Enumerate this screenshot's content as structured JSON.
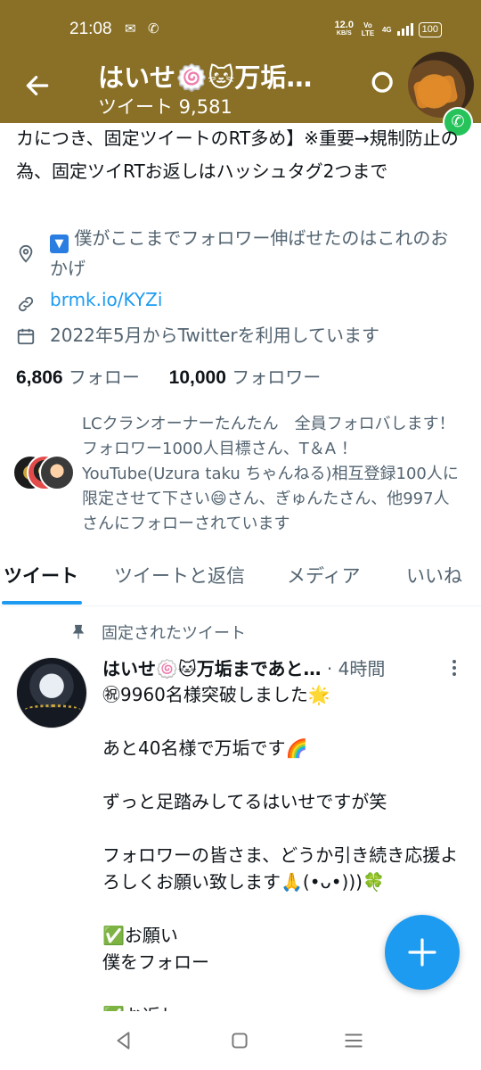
{
  "status_bar": {
    "time": "21:08",
    "speed_value": "12.0",
    "speed_unit": "KB/S",
    "volte": "Vo LTE",
    "network": "4G",
    "battery": "100"
  },
  "header": {
    "display_name": "はいせ🍥🐱万垢…",
    "tweet_count": "ツイート 9,581"
  },
  "profile": {
    "bio": "カにつき、固定ツイートのRT多め】※重要→規制防止の為、固定ツイRTお返しはハッシュタグ2つまで",
    "location_box": "▼",
    "location_text": "僕がここまでフォロワー伸ばせたのはこれのおかげ",
    "website": "brmk.io/KYZi",
    "joined": "2022年5月からTwitterを利用しています",
    "following_count": "6,806",
    "following_label": "フォロー",
    "followers_count": "10,000",
    "followers_label": "フォロワー",
    "mutual_text": "LCクランオーナーたんたん　全員フォロバします！フォロワー1000人目標さん、T＆A ！YouTube(Uzura taku ちゃんねる)相互登録100人に限定させて下さい😄さん、ぎゅんたさん、他997人さんにフォローされています"
  },
  "tabs": [
    {
      "label": "ツイート"
    },
    {
      "label": "ツイートと返信"
    },
    {
      "label": "メディア"
    },
    {
      "label": "いいね"
    }
  ],
  "pinned_tweet": {
    "pinned_label": "固定されたツイート",
    "author": "はいせ🍥🐱万垢まであと…",
    "time": "· 4時間",
    "body": "㊗9960名様突破しました🌟\n\nあと40名様で万垢です🌈\n\nずっと足踏みしてるはいせですが笑\n\nフォロワーの皆さま、どうか引き続き応援よろしくお願い致します🙏(•ᴗ•)))🍀\n\n✅お願い\n僕をフォロー\n\n✅お返し"
  },
  "colors": {
    "header_bg": "#8a7026",
    "accent": "#1d9bf0",
    "call_badge": "#25c35a"
  }
}
